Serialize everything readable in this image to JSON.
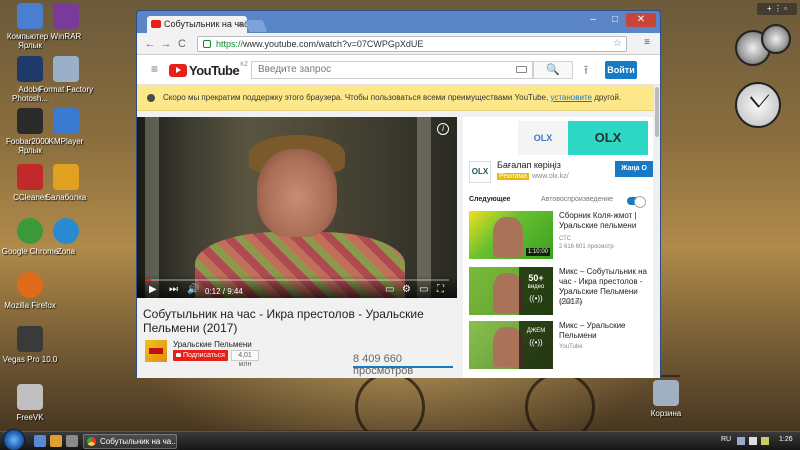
{
  "desktop": {
    "icons": [
      {
        "label": "Компьютер - Ярлык",
        "color": "#4a7fd0"
      },
      {
        "label": "WinRAR",
        "color": "#7a3a9a"
      },
      {
        "label": "Adobe Photosh...",
        "color": "#1f3a6a"
      },
      {
        "label": "Format Factory",
        "color": "#9ab0c8"
      },
      {
        "label": "Foobar2000 - Ярлык",
        "color": "#2a2a2a"
      },
      {
        "label": "KMPlayer",
        "color": "#3a7ad0"
      },
      {
        "label": "CCleaner",
        "color": "#c02a2a"
      },
      {
        "label": "Балаболка",
        "color": "#e0a020"
      },
      {
        "label": "Google Chrome",
        "color": "#3a9a3a"
      },
      {
        "label": "Zona",
        "color": "#2a8ad0"
      },
      {
        "label": "Mozilla Firefox",
        "color": "#e06a1a"
      },
      {
        "label": "Vegas Pro 10.0",
        "color": "#3a3a3a"
      },
      {
        "label": "FreeVK",
        "color": "#c0c0c0"
      },
      {
        "label": "Корзина",
        "color": "#a0b0c0"
      }
    ],
    "gadget_bar": "+ ⋮ ▫"
  },
  "browser": {
    "tab_title": "Собутыльник на час",
    "tab_close": "×",
    "window_buttons": {
      "minimize": "–",
      "maximize": "□",
      "close": "✕"
    },
    "nav": {
      "back": "←",
      "forward": "→",
      "reload": "C"
    },
    "url_scheme": "https://",
    "url_rest": "www.youtube.com/watch?v=07CWPGpXdUE",
    "star": "☆",
    "menu": "≡"
  },
  "youtube": {
    "hamburger": "≡",
    "logo_word": "YouTube",
    "logo_region": "KZ",
    "search_placeholder": "Введите запрос",
    "search_button": "🔍",
    "upload": "⭱",
    "signin": "Войти",
    "banner_text": "Скоро мы прекратим поддержку этого браузера. Чтобы пользоваться всеми преимуществами YouTube,",
    "banner_link": "установите",
    "banner_tail": " другой.",
    "player": {
      "info": "i",
      "play": "▶",
      "next": "⏭",
      "volume": "🔊",
      "time": "0:12 / 9:44",
      "progress": 0.02,
      "subtitles": "▭",
      "settings": "⚙",
      "theater": "▭",
      "fullscreen": "⛶"
    },
    "video_title": "Собутыльник на час - Икра престолов - Уральские Пельмени (2017)",
    "channel_name": "Уральские Пельмени",
    "subscribe": "Подписаться",
    "sub_count": "4,01 млн",
    "views": "8 409 660 просмотров",
    "ad": {
      "strip_left": "OLX",
      "strip_right": "OLX",
      "logo": "OLX",
      "title": "Бағалап көріңіз",
      "badge": "Реклама",
      "domain": "www.olx.kz/",
      "button": "Жаңа О"
    },
    "next_label": "Следующее",
    "autoplay_label": "Автовоспроизведение",
    "recommendations": [
      {
        "title": "Сборник Коля-жмот | Уральские пельмени",
        "channel": "СТС",
        "views": "2 616 601 просмотр",
        "duration": "1:10:00",
        "mix": false
      },
      {
        "title": "Микс – Собутыльник на час - Икра престолов - Уральские Пельмени (2017)",
        "channel": "YouTube",
        "views": "",
        "mix": true,
        "mix_count": "50+",
        "mix_label": "видео"
      },
      {
        "title": "Микс – Уральские Пельмени",
        "channel": "YouTube",
        "views": "",
        "mix": true,
        "mix_count": "",
        "mix_label": "ДЖЕМ"
      }
    ]
  },
  "taskbar": {
    "task_title": "Собутыльник на ча...",
    "lang": "RU",
    "time": "1:26"
  }
}
